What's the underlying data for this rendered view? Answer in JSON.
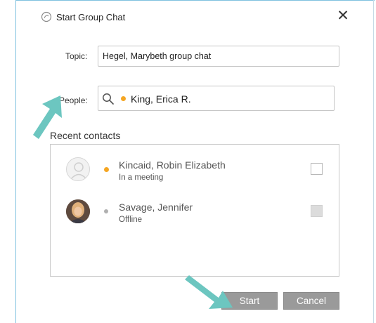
{
  "dialog": {
    "title": "Start Group Chat",
    "close_glyph": "✕"
  },
  "topic": {
    "label": "Topic:",
    "value": "Hegel, Marybeth group chat"
  },
  "people": {
    "label": "People:",
    "value": "King, Erica R.",
    "presence": "away"
  },
  "recent_contacts": {
    "heading": "Recent contacts",
    "items": [
      {
        "name": "Kincaid, Robin Elizabeth",
        "status": "In a meeting",
        "presence": "busy-meeting",
        "checked": false
      },
      {
        "name": "Savage, Jennifer",
        "status": "Offline",
        "presence": "offline",
        "checked": false
      }
    ]
  },
  "buttons": {
    "start": "Start",
    "cancel": "Cancel"
  },
  "colors": {
    "presence_away": "#f5a623",
    "presence_offline": "#b0b0b0",
    "annotation_arrow": "#6cc6c0",
    "frame": "#7fc2df",
    "button": "#9a9a9a"
  },
  "icons": {
    "app": "chat-app-icon",
    "search": "search-icon",
    "arrows": "annotation-arrow"
  }
}
